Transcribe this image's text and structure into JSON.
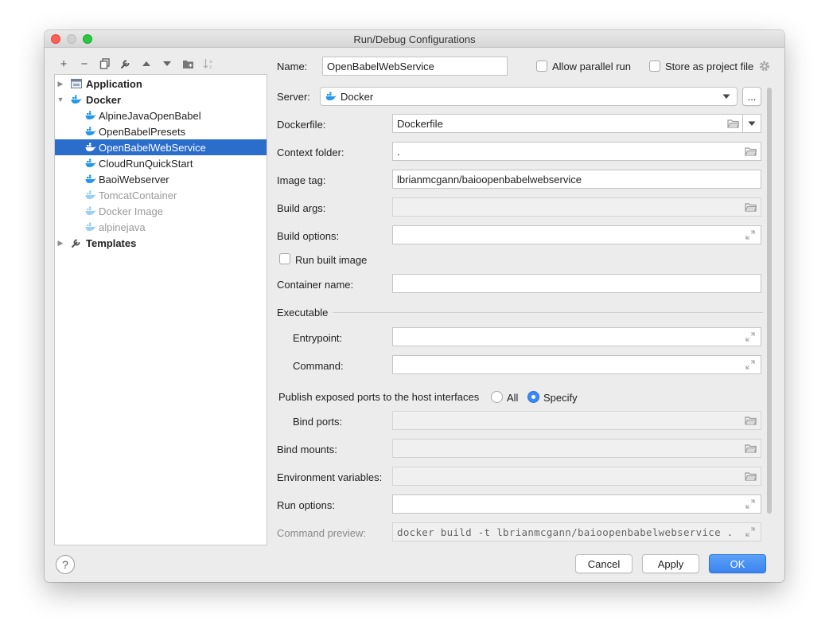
{
  "window": {
    "title": "Run/Debug Configurations"
  },
  "toolbar": {
    "add": "+",
    "remove": "−",
    "copy": "⧉",
    "edit": "🔧",
    "up": "▲",
    "down": "▼",
    "folder": "📁",
    "sort": "↓ᵃ"
  },
  "tree": {
    "groups": [
      {
        "label": "Application",
        "icon": "application-icon",
        "expanded": false
      },
      {
        "label": "Docker",
        "icon": "docker-icon",
        "expanded": true
      },
      {
        "label": "Templates",
        "icon": "wrench-icon",
        "expanded": false
      }
    ],
    "docker_items": [
      {
        "label": "AlpineJavaOpenBabel",
        "dimmed": false
      },
      {
        "label": "OpenBabelPresets",
        "dimmed": false
      },
      {
        "label": "OpenBabelWebService",
        "selected": true
      },
      {
        "label": "CloudRunQuickStart",
        "dimmed": false
      },
      {
        "label": "BaoiWebserver",
        "dimmed": false
      },
      {
        "label": "TomcatContainer",
        "dimmed": true
      },
      {
        "label": "Docker Image",
        "dimmed": true
      },
      {
        "label": "alpinejava",
        "dimmed": true
      }
    ]
  },
  "form": {
    "name_label": "Name:",
    "name_value": "OpenBabelWebService",
    "allow_parallel": "Allow parallel run",
    "store_project": "Store as project file",
    "server_label": "Server:",
    "server_value": "Docker",
    "ellipsis": "...",
    "dockerfile_label": "Dockerfile:",
    "dockerfile_value": "Dockerfile",
    "context_label": "Context folder:",
    "context_value": ".",
    "image_tag_label": "Image tag:",
    "image_tag_value": "lbrianmcgann/baioopenbabelwebservice",
    "build_args_label": "Build args:",
    "build_options_label": "Build options:",
    "run_built_image": "Run built image",
    "container_name_label": "Container name:",
    "executable_label": "Executable",
    "entrypoint_label": "Entrypoint:",
    "command_label": "Command:",
    "publish_label": "Publish exposed ports to the host interfaces",
    "radio_all": "All",
    "radio_specify": "Specify",
    "bind_ports_label": "Bind ports:",
    "bind_mounts_label": "Bind mounts:",
    "env_vars_label": "Environment variables:",
    "run_options_label": "Run options:",
    "command_preview_label": "Command preview:",
    "command_preview_value": "docker build -t lbrianmcgann/baioopenbabelwebservice ."
  },
  "buttons": {
    "help": "?",
    "cancel": "Cancel",
    "apply": "Apply",
    "ok": "OK"
  },
  "colors": {
    "selection": "#2b6dcb",
    "primary": "#3a83ed",
    "docker": "#2496ed"
  }
}
